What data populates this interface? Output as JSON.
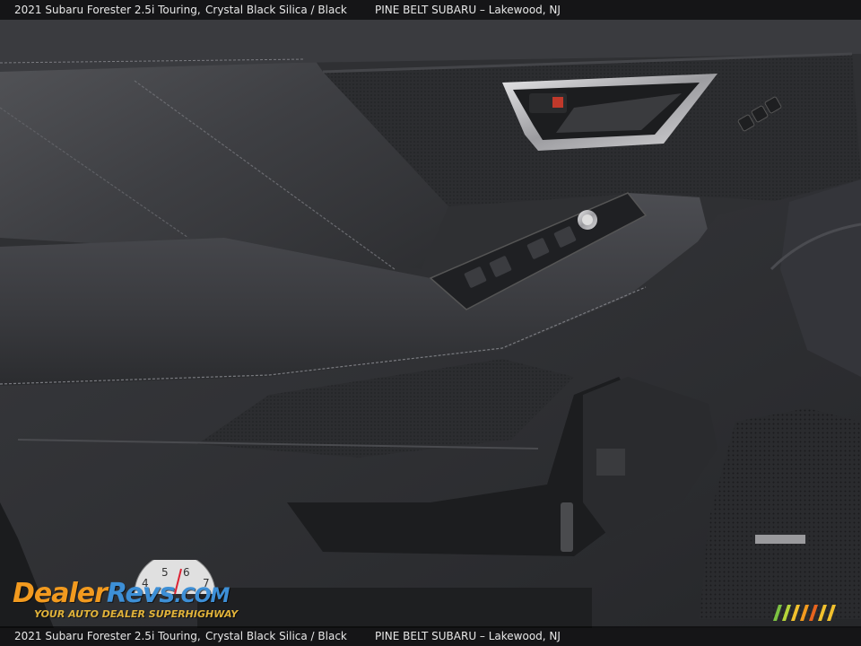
{
  "caption": {
    "model": "2021 Subaru Forester 2.5i Touring,",
    "color": "Crystal Black Silica / Black",
    "dealer": "PINE BELT SUBARU – Lakewood, NJ"
  },
  "watermark": {
    "brand_part1": "Dealer",
    "brand_part2": "Revs",
    "brand_part3": ".COM",
    "tagline": "YOUR AUTO DEALER SUPERHIGHWAY",
    "gauge_digits": [
      "4",
      "5",
      "6",
      "7"
    ]
  },
  "colors": {
    "leather": "#3b3c40",
    "leather_dark": "#222326",
    "chrome": "#c9c9cc",
    "brand_orange": "#f29a1f",
    "brand_blue": "#3d8fd6"
  },
  "icons": [
    "door-handle-icon",
    "window-switch-icon",
    "mirror-knob-icon",
    "seat-memory-buttons-icon",
    "speaker-grille-icon"
  ]
}
